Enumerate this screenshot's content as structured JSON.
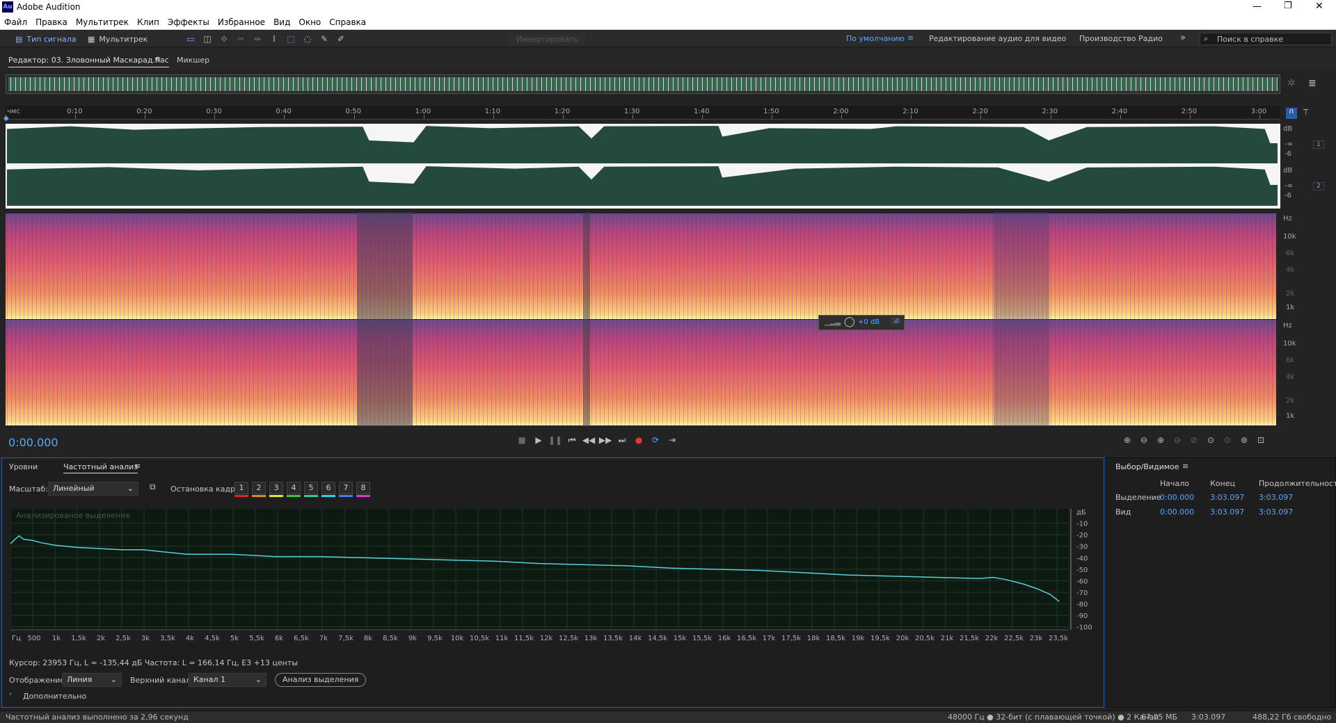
{
  "app": {
    "title": "Adobe Audition",
    "logo": "Au"
  },
  "menu": [
    "Файл",
    "Правка",
    "Мультитрек",
    "Клип",
    "Эффекты",
    "Избранное",
    "Вид",
    "Окно",
    "Справка"
  ],
  "toolbar": {
    "waveform_label": "Тип сигнала",
    "multitrack_label": "Мультитрек",
    "invert_label": "Инвертировать",
    "workspaces": [
      "По умолчанию",
      "Редактирование аудио для видео",
      "Производство Радио"
    ],
    "help_placeholder": "Поиск в справке"
  },
  "editor": {
    "tab_label": "Редактор: 03. Зловонный Маскарад.flac",
    "mixer_label": "Микшер"
  },
  "ruler": {
    "ticks": [
      "чмс",
      "0:10",
      "0:20",
      "0:30",
      "0:40",
      "0:50",
      "1:00",
      "1:10",
      "1:20",
      "1:30",
      "1:40",
      "1:50",
      "2:00",
      "2:10",
      "2:20",
      "2:30",
      "2:40",
      "2:50",
      "3:00"
    ]
  },
  "waveform": {
    "channels": [
      {
        "db_label": "dB",
        "inf": "-∞",
        "m6": "-6",
        "num": "1"
      },
      {
        "db_label": "dB",
        "inf": "-∞",
        "m6": "-6",
        "num": "2"
      }
    ]
  },
  "spectral": {
    "labels": [
      "Hz",
      "10k",
      "6k",
      "4k",
      "2k",
      "1k"
    ],
    "hud_value": "+0 dB"
  },
  "transport": {
    "time": "0:00.000"
  },
  "freq": {
    "tab_levels": "Уровни",
    "tab_freq": "Частотный анализ",
    "scale_label": "Масштаб:",
    "scale_value": "Линейный",
    "frame_label": "Остановка кадра:",
    "frame_buttons": [
      "1",
      "2",
      "3",
      "4",
      "5",
      "6",
      "7",
      "8"
    ],
    "frame_colors": [
      "#e0242a",
      "#e08a1c",
      "#f0e02c",
      "#3cc43c",
      "#1fd0a0",
      "#2ad0ff",
      "#3a7aff",
      "#e030e0"
    ],
    "plot_title": "Анализированое выделение",
    "cursor_text": "Курсор: 23953 Гц, L = -135,44 дБ Частота: L = 166,14 Гц, E3 +13 центы",
    "display_label": "Отображение:",
    "display_value": "Линия",
    "channel_label": "Верхний канал:",
    "channel_value": "Канал 1",
    "analyze_button": "Анализ выделения",
    "advanced_label": "Дополнительно"
  },
  "selection": {
    "title": "Выбор/Видимое",
    "hdr_start": "Начало",
    "hdr_end": "Конец",
    "hdr_dur": "Продолжительность",
    "rows": [
      {
        "label": "Выделение",
        "start": "0:00.000",
        "end": "3:03.097",
        "dur": "3:03.097"
      },
      {
        "label": "Вид",
        "start": "0:00.000",
        "end": "3:03.097",
        "dur": "3:03.097"
      }
    ]
  },
  "status": {
    "left": "Частотный анализ выполнено за 2,96 секунд",
    "sample": "48000 Гц ● 32-бит (с плавающей точкой) ● 2 Канал",
    "size": "67,05 МБ",
    "dur": "3:03.097",
    "free": "488,22 Гб свободно"
  },
  "chart_data": {
    "type": "line",
    "x_tick_labels": [
      "Гц",
      "500",
      "1k",
      "1,5k",
      "2k",
      "2,5k",
      "3k",
      "3,5k",
      "4k",
      "4,5k",
      "5k",
      "5,5k",
      "6k",
      "6,5k",
      "7k",
      "7,5k",
      "8k",
      "8,5k",
      "9k",
      "9,5k",
      "10k",
      "10,5k",
      "11k",
      "11,5k",
      "12k",
      "12,5k",
      "13k",
      "13,5k",
      "14k",
      "14,5k",
      "15k",
      "15,5k",
      "16k",
      "16,5k",
      "17k",
      "17,5k",
      "18k",
      "18,5k",
      "19k",
      "19,5k",
      "20k",
      "20,5k",
      "21k",
      "21,5k",
      "22k",
      "22,5k",
      "23k",
      "23,5k"
    ],
    "y_tick_labels": [
      "дБ",
      "-10",
      "-20",
      "-30",
      "-40",
      "-50",
      "-60",
      "-70",
      "-80",
      "-90",
      "-100"
    ],
    "ylim": [
      -105,
      0
    ],
    "x": [
      0,
      100,
      200,
      300,
      500,
      700,
      1000,
      1500,
      2000,
      2500,
      3000,
      3500,
      4000,
      5000,
      6000,
      7000,
      8000,
      9000,
      10000,
      11000,
      12000,
      13000,
      14000,
      15000,
      16000,
      17000,
      18000,
      19000,
      20000,
      21000,
      22000,
      22300,
      22600,
      23000,
      23300,
      23600,
      23800
    ],
    "series": [
      {
        "values": [
          -28,
          -24,
          -21,
          -24,
          -25,
          -27,
          -29,
          -31,
          -32,
          -33,
          -33,
          -35,
          -37,
          -37,
          -39,
          -39,
          -40,
          -41,
          -42,
          -43,
          -45,
          -46,
          -47,
          -49,
          -50,
          -51,
          -53,
          -55,
          -56,
          -57,
          -58,
          -57,
          -59,
          -63,
          -67,
          -72,
          -78
        ]
      }
    ],
    "grid": true
  }
}
